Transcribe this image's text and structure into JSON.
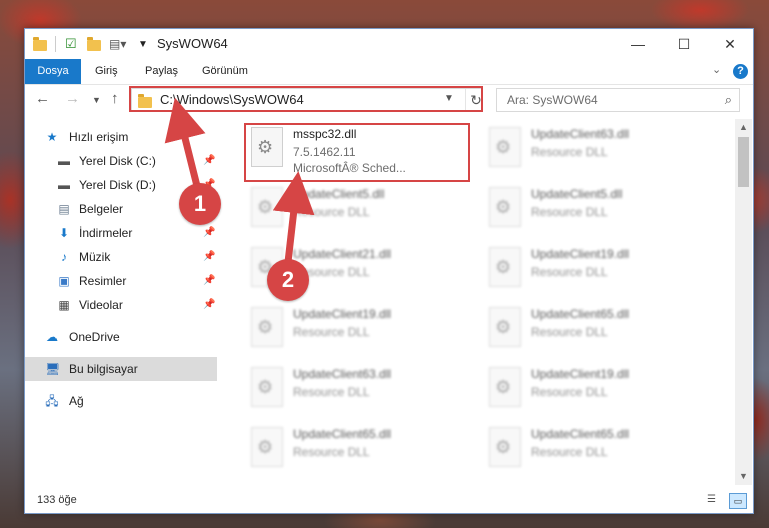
{
  "window": {
    "title": "SysWOW64",
    "controls": {
      "minimize": "—",
      "maximize": "☐",
      "close": "✕"
    }
  },
  "ribbon": {
    "tabs": [
      {
        "label": "Dosya",
        "active": true
      },
      {
        "label": "Giriş"
      },
      {
        "label": "Paylaş"
      },
      {
        "label": "Görünüm"
      }
    ],
    "help_icon": "?"
  },
  "navigation": {
    "address_path": "C:\\Windows\\SysWOW64",
    "search_placeholder": "Ara: SysWOW64"
  },
  "sidebar": {
    "items": [
      {
        "label": "Hızlı erişim",
        "icon": "star-icon",
        "pinned": false
      },
      {
        "label": "Yerel Disk (C:)",
        "icon": "drive-icon",
        "pinned": true
      },
      {
        "label": "Yerel Disk (D:)",
        "icon": "drive-icon",
        "pinned": true
      },
      {
        "label": "Belgeler",
        "icon": "documents-icon",
        "pinned": true
      },
      {
        "label": "İndirmeler",
        "icon": "download-icon",
        "pinned": true
      },
      {
        "label": "Müzik",
        "icon": "music-icon",
        "pinned": true
      },
      {
        "label": "Resimler",
        "icon": "pictures-icon",
        "pinned": true
      },
      {
        "label": "Videolar",
        "icon": "video-icon",
        "pinned": true
      },
      {
        "label": "OneDrive",
        "icon": "cloud-icon",
        "pinned": false
      },
      {
        "label": "Bu bilgisayar",
        "icon": "computer-icon",
        "pinned": false,
        "selected": true
      },
      {
        "label": "Ağ",
        "icon": "network-icon",
        "pinned": false
      }
    ]
  },
  "files": {
    "highlighted": {
      "name": "msspc32.dll",
      "version": "7.5.1462.11",
      "description": "MicrosoftÂ® Sched..."
    },
    "background": [
      {
        "name": "UpdateClient63.dll",
        "type": "Resource DLL"
      },
      {
        "name": "UpdateClient5.dll",
        "type": "Resource DLL"
      },
      {
        "name": "UpdateClient5.dll",
        "type": "Resource DLL"
      },
      {
        "name": "UpdateClient21.dll",
        "type": "Resource DLL"
      },
      {
        "name": "UpdateClient19.dll",
        "type": "Resource DLL"
      },
      {
        "name": "UpdateClient19.dll",
        "type": "Resource DLL"
      },
      {
        "name": "UpdateClient65.dll",
        "type": "Resource DLL"
      },
      {
        "name": "UpdateClient63.dll",
        "type": "Resource DLL"
      },
      {
        "name": "UpdateClient19.dll",
        "type": "Resource DLL"
      },
      {
        "name": "UpdateClient65.dll",
        "type": "Resource DLL"
      },
      {
        "name": "UpdateClient65.dll",
        "type": "Resource DLL"
      }
    ]
  },
  "status": {
    "item_count": "133 öğe"
  },
  "annotations": {
    "step1": "1",
    "step2": "2",
    "color": "#d64545"
  }
}
